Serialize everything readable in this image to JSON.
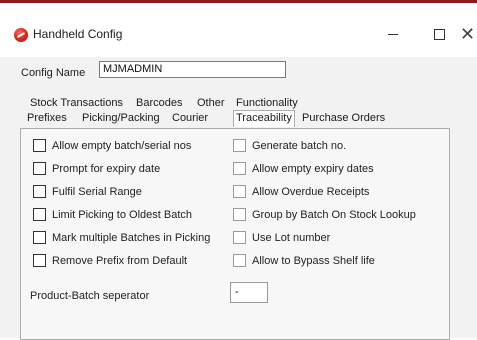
{
  "window": {
    "title": "Handheld Config",
    "minimize": "",
    "maximize": "",
    "close": "✕"
  },
  "config_name": {
    "label": "Config Name",
    "value": "MJMADMIN"
  },
  "tabs_top": [
    "Stock Transactions",
    "Barcodes",
    "Other",
    "Functionality"
  ],
  "tabs_bottom": [
    "Prefixes",
    "Picking/Packing",
    "Courier",
    "Traceability",
    "Purchase Orders"
  ],
  "active_tab": "Traceability",
  "checkboxes_left": [
    {
      "label": "Allow empty batch/serial nos",
      "checked": false
    },
    {
      "label": "Prompt for expiry date",
      "checked": false
    },
    {
      "label": "Fulfil Serial Range",
      "checked": false
    },
    {
      "label": "Limit Picking to Oldest Batch",
      "checked": false
    },
    {
      "label": "Mark multiple Batches in Picking",
      "checked": false
    },
    {
      "label": "Remove Prefix from Default",
      "checked": false
    }
  ],
  "checkboxes_right": [
    {
      "label": "Generate batch no.",
      "checked": false
    },
    {
      "label": "Allow empty expiry dates",
      "checked": false
    },
    {
      "label": "Allow Overdue Receipts",
      "checked": false
    },
    {
      "label": "Group by Batch On Stock Lookup",
      "checked": false
    },
    {
      "label": "Use Lot number",
      "checked": false
    },
    {
      "label": "Allow to Bypass Shelf life",
      "checked": false
    }
  ],
  "batch_separator": {
    "label": "Product-Batch seperator",
    "value": "-"
  }
}
